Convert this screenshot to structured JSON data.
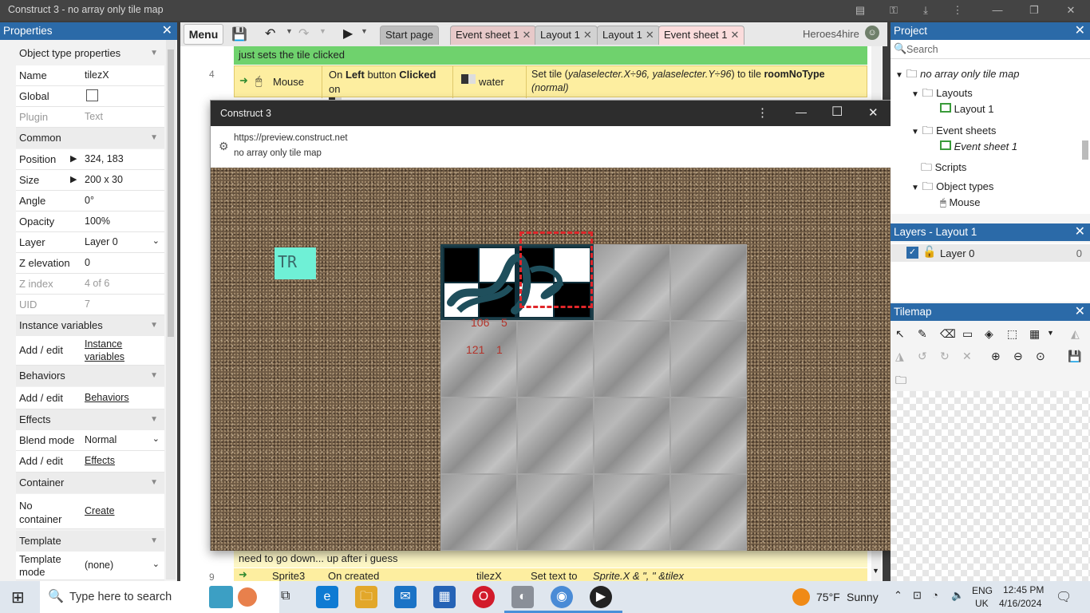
{
  "window": {
    "title": "Construct 3 - no array only tile map"
  },
  "properties": {
    "panel_title": "Properties",
    "header": "Object type properties",
    "name_label": "Name",
    "name_value": "tilezX",
    "global_label": "Global",
    "plugin_label": "Plugin",
    "plugin_value": "Text",
    "common_label": "Common",
    "position_label": "Position",
    "position_value": "324, 183",
    "size_label": "Size",
    "size_value": "200 x 30",
    "angle_label": "Angle",
    "angle_value": "0°",
    "opacity_label": "Opacity",
    "opacity_value": "100%",
    "layer_label": "Layer",
    "layer_value": "Layer 0",
    "zelev_label": "Z elevation",
    "zelev_value": "0",
    "zindex_label": "Z index",
    "zindex_value": "4 of 6",
    "uid_label": "UID",
    "uid_value": "7",
    "instvars_label": "Instance variables",
    "addedit_label": "Add / edit",
    "instvars_link": "Instance variables",
    "behaviors_label": "Behaviors",
    "behaviors_link": "Behaviors",
    "effects_label": "Effects",
    "blend_label": "Blend mode",
    "blend_value": "Normal",
    "effects_link": "Effects",
    "container_label": "Container",
    "nocontainer_label": "No container",
    "create_link": "Create",
    "template_label": "Template",
    "templatemode_label": "Template mode",
    "templatemode_value": "(none)"
  },
  "toolbar": {
    "menu_label": "Menu",
    "tabs": [
      "Start page",
      "Event sheet 1",
      "Layout 1",
      "Layout 1",
      "Event sheet 1"
    ],
    "user": "Heroes4hire"
  },
  "events": {
    "comment1": "just sets the tile clicked",
    "row_number": "4",
    "mouse_label": "Mouse",
    "condition_pre": "On",
    "condition_left": "Left",
    "condition_mid": "button",
    "condition_clicked": "Clicked",
    "condition_on": "on",
    "condition_obj": "water",
    "action_obj": "water",
    "action_text_1": "Set tile (",
    "action_text_2": "yalaselecter.X÷96, yalaselecter.Y÷96",
    "action_text_3": ") to tile",
    "action_bold": "roomNoType",
    "action_text_4": "(normal)",
    "comment2": "need to go down... up after i guess",
    "row9_number": "9",
    "row9_obj": "Sprite3",
    "row9_cond": "On created",
    "row9_target": "tilezX",
    "row9_action_pre": "Set text to",
    "row9_action_expr": "Sprite.X & \", \" &tilex"
  },
  "preview": {
    "title": "Construct 3",
    "url": "https://preview.construct.net",
    "page_title": "no array only tile map",
    "tr_label": "TR",
    "debug_line1_a": "106",
    "debug_line1_b": "5",
    "debug_line2_a": "121",
    "debug_line2_b": "1"
  },
  "project": {
    "panel_title": "Project",
    "search_placeholder": "Search",
    "root": "no array only tile map",
    "layouts": "Layouts",
    "layout1": "Layout 1",
    "eventsheets": "Event sheets",
    "eventsheet1": "Event sheet 1",
    "scripts": "Scripts",
    "objecttypes": "Object types",
    "mouse": "Mouse"
  },
  "layers": {
    "panel_title": "Layers - Layout 1",
    "layer0": "Layer 0",
    "layer0_index": "0"
  },
  "tilemap": {
    "panel_title": "Tilemap"
  },
  "taskbar": {
    "search_placeholder": "Type here to search",
    "weather_temp": "75°F",
    "weather_desc": "Sunny",
    "lang_1": "ENG",
    "lang_2": "UK",
    "time": "12:45 PM",
    "date": "4/16/2024"
  },
  "colors": {
    "accent": "#2b6aa8",
    "event_yellow": "#fdeea0",
    "comment_green": "#6fd26d",
    "tr_cyan": "#6ff0d6",
    "selection_red": "#e0262a"
  }
}
